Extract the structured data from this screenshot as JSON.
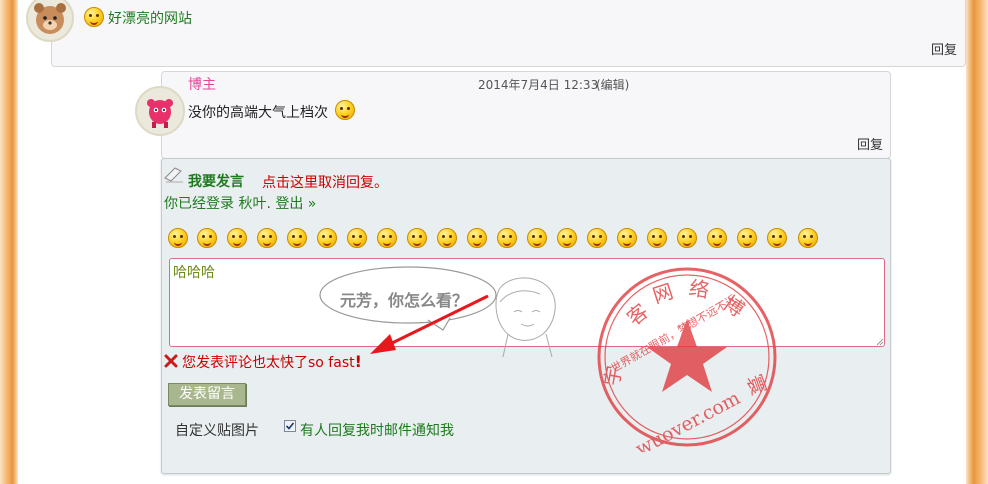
{
  "comment1": {
    "text": "好漂亮的网站",
    "reply_label": "回复"
  },
  "comment2": {
    "author": "博主",
    "timestamp": "2014年7月4日 12:33",
    "edit_label": "(编辑)",
    "text": "没你的高端大气上档次",
    "reply_label": "回复"
  },
  "form": {
    "title": "我要发言",
    "cancel_reply": "点击这里取消回复。",
    "logged_in_prefix": "你已经登录",
    "username": "秋叶",
    "logout": "登出 »",
    "textarea_value": "哈哈哈",
    "error_message": "您发表评论也太快了so fast",
    "error_mark": "!",
    "submit_label": "发表留言",
    "custom_image": "自定义贴图片",
    "notify_label": "有人回复我时邮件通知我",
    "notify_checked": true
  },
  "annotation": {
    "bubble_text": "元芳，你怎么看？"
  },
  "stamp": {
    "top_text": [
      "网",
      "络",
      "博",
      "客",
      "宇",
      "寰"
    ],
    "inner_text": "世界就在眼前，梦想不远不近",
    "bottom_text": "wuover.com"
  },
  "emoticons": [
    "smile-icon",
    "angry-icon",
    "grin-icon",
    "cry-icon",
    "laugh-icon",
    "mad-icon",
    "confused-icon",
    "frustrated-icon",
    "shock-icon",
    "kiss-icon",
    "thinking-icon",
    "cool-icon",
    "happy-icon",
    "dizzy-icon",
    "sneeze-icon",
    "wow-icon",
    "sad-icon",
    "yell-icon",
    "surprise-icon",
    "content-icon",
    "wink-icon",
    "tongue-icon"
  ],
  "colors": {
    "frame": "#e8963c",
    "stamp": "#e0373b",
    "author": "#e0489a",
    "error": "#cc0000",
    "arrow": "#e8171c"
  }
}
